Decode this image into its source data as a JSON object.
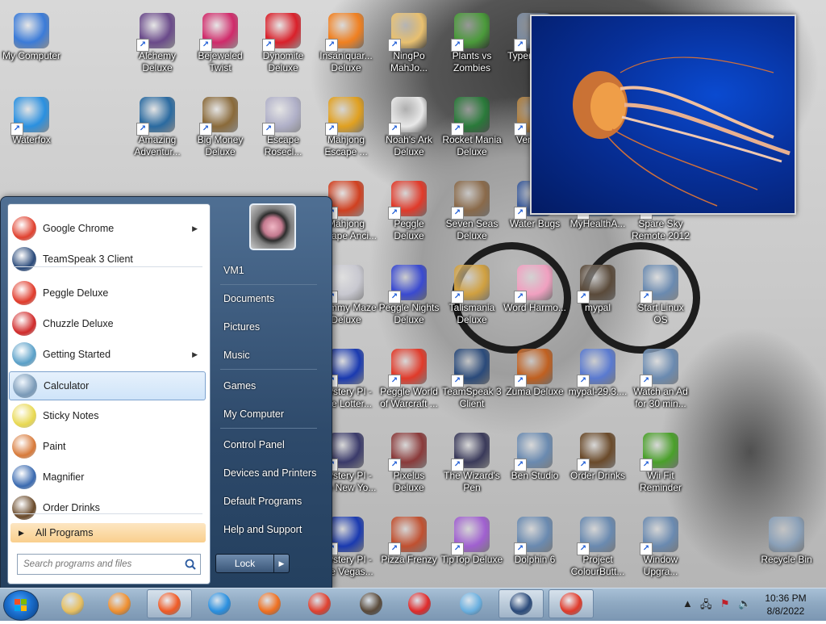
{
  "desktop": {
    "icons": [
      {
        "label": "My Computer",
        "color": "#3b7bd8"
      },
      {
        "label": "Waterfox",
        "color": "#2a90e0"
      },
      {
        "label": "Alchemy Deluxe",
        "color": "#6a4a8a"
      },
      {
        "label": "Bejeweled Twist",
        "color": "#d02a6a"
      },
      {
        "label": "Dynomite Deluxe",
        "color": "#d9202a"
      },
      {
        "label": "Insaniquar... Deluxe",
        "color": "#f08020"
      },
      {
        "label": "NingPo MahJo...",
        "color": "#e8c070"
      },
      {
        "label": "Plants vs Zombies",
        "color": "#4a9a3a"
      },
      {
        "label": "Typer... De...",
        "color": "#7a8aa0"
      },
      {
        "label": "Amazing Adventur...",
        "color": "#2a6aa0"
      },
      {
        "label": "Big Money Deluxe",
        "color": "#8a6a3a"
      },
      {
        "label": "Escape Rosecl...",
        "color": "#b0b0c8"
      },
      {
        "label": "Mahjong Escape ...",
        "color": "#e0a020"
      },
      {
        "label": "Noah's Ark Deluxe",
        "color": "#e8e8e8"
      },
      {
        "label": "Rocket Mania Deluxe",
        "color": "#2a7a3a"
      },
      {
        "label": "Venice...",
        "color": "#b08040"
      },
      {
        "label": "Mahjong Escape Anci...",
        "color": "#d04020"
      },
      {
        "label": "Peggle Deluxe",
        "color": "#e03a2a"
      },
      {
        "label": "Seven Seas Deluxe",
        "color": "#8a6a4a"
      },
      {
        "label": "Water Bugs",
        "color": "#3a5a9a"
      },
      {
        "label": "MyHealthA...",
        "color": "#6a8ab0"
      },
      {
        "label": "Spare Sky Remote 2012",
        "color": "#6a8ab0"
      },
      {
        "label": "Mummy Maze Deluxe",
        "color": "#c8c8d0"
      },
      {
        "label": "Peggle Nights Deluxe",
        "color": "#3a4ad0"
      },
      {
        "label": "Talismania Deluxe",
        "color": "#d0a040"
      },
      {
        "label": "Word Harmo...",
        "color": "#f0a0c0"
      },
      {
        "label": "mypal",
        "color": "#5a4a3a"
      },
      {
        "label": "Start Linux OS",
        "color": "#6a8ab0"
      },
      {
        "label": "Mystery PI - The Lotter...",
        "color": "#1a3ab0"
      },
      {
        "label": "Peggle World of Warcraft ...",
        "color": "#e03a2a"
      },
      {
        "label": "TeamSpeak 3 Client",
        "color": "#2a4a7a"
      },
      {
        "label": "Zuma Deluxe",
        "color": "#c06020"
      },
      {
        "label": "mypal-29.3....",
        "color": "#5a7ad0"
      },
      {
        "label": "Watch an Ad for 30 min...",
        "color": "#6a8ab0"
      },
      {
        "label": "Mystery PI - The New Yo...",
        "color": "#3a3a6a"
      },
      {
        "label": "Pixelus Deluxe",
        "color": "#8a3a3a"
      },
      {
        "label": "The Wizard's Pen",
        "color": "#3a3a5a"
      },
      {
        "label": "Ben Studio",
        "color": "#6a8ab0"
      },
      {
        "label": "Order Drinks",
        "color": "#6a4a2a"
      },
      {
        "label": "Wii Fit Reminder",
        "color": "#4aa02a"
      },
      {
        "label": "Mystery PI - The Vegas...",
        "color": "#1a3ab0"
      },
      {
        "label": "Pizza Frenzy",
        "color": "#c05030"
      },
      {
        "label": "TipTop Deluxe",
        "color": "#a060d0"
      },
      {
        "label": "Dolphin 6",
        "color": "#6a8ab0"
      },
      {
        "label": "Project ColourButt...",
        "color": "#6a8ab0"
      },
      {
        "label": "Window Upgra...",
        "color": "#6a8ab0"
      },
      {
        "label": "Recycle Bin",
        "color": "#8aa0b8"
      }
    ]
  },
  "start_menu": {
    "programs": [
      {
        "label": "Google Chrome",
        "color": "#e0412f",
        "submenu": true
      },
      {
        "label": "TeamSpeak 3 Client",
        "color": "#2a4a7a",
        "submenu": false
      },
      {
        "label": "Peggle Deluxe",
        "color": "#e03a2a",
        "submenu": false
      },
      {
        "label": "Chuzzle Deluxe",
        "color": "#d02a2a",
        "submenu": false
      },
      {
        "label": "Getting Started",
        "color": "#5aa0c8",
        "submenu": true
      },
      {
        "label": "Calculator",
        "color": "#7a9ab8",
        "submenu": false
      },
      {
        "label": "Sticky Notes",
        "color": "#e8d850",
        "submenu": false
      },
      {
        "label": "Paint",
        "color": "#d87a3a",
        "submenu": false
      },
      {
        "label": "Magnifier",
        "color": "#3a6ab0",
        "submenu": false
      },
      {
        "label": "Order Drinks",
        "color": "#6a4a2a",
        "submenu": false
      }
    ],
    "all_programs": "All Programs",
    "search_placeholder": "Search programs and files",
    "right_items": [
      "VM1",
      "Documents",
      "Pictures",
      "Music",
      "Games",
      "My Computer",
      "Control Panel",
      "Devices and Printers",
      "Default Programs",
      "Help and Support"
    ],
    "lock_label": "Lock"
  },
  "taskbar": {
    "apps": [
      {
        "name": "file-explorer",
        "color": "#e8c060"
      },
      {
        "name": "media-player",
        "color": "#f09030"
      },
      {
        "name": "brave",
        "color": "#f05a24"
      },
      {
        "name": "waterfox",
        "color": "#2a90e0"
      },
      {
        "name": "firefox",
        "color": "#f07020"
      },
      {
        "name": "chrome",
        "color": "#e0412f"
      },
      {
        "name": "mypal",
        "color": "#5a4a3a"
      },
      {
        "name": "yandex",
        "color": "#e02a2a"
      },
      {
        "name": "notepad",
        "color": "#6ab0e0"
      },
      {
        "name": "teamspeak",
        "color": "#2a4a7a"
      },
      {
        "name": "peggle",
        "color": "#e03a2a"
      }
    ],
    "time": "10:36 PM",
    "date": "8/8/2022"
  }
}
